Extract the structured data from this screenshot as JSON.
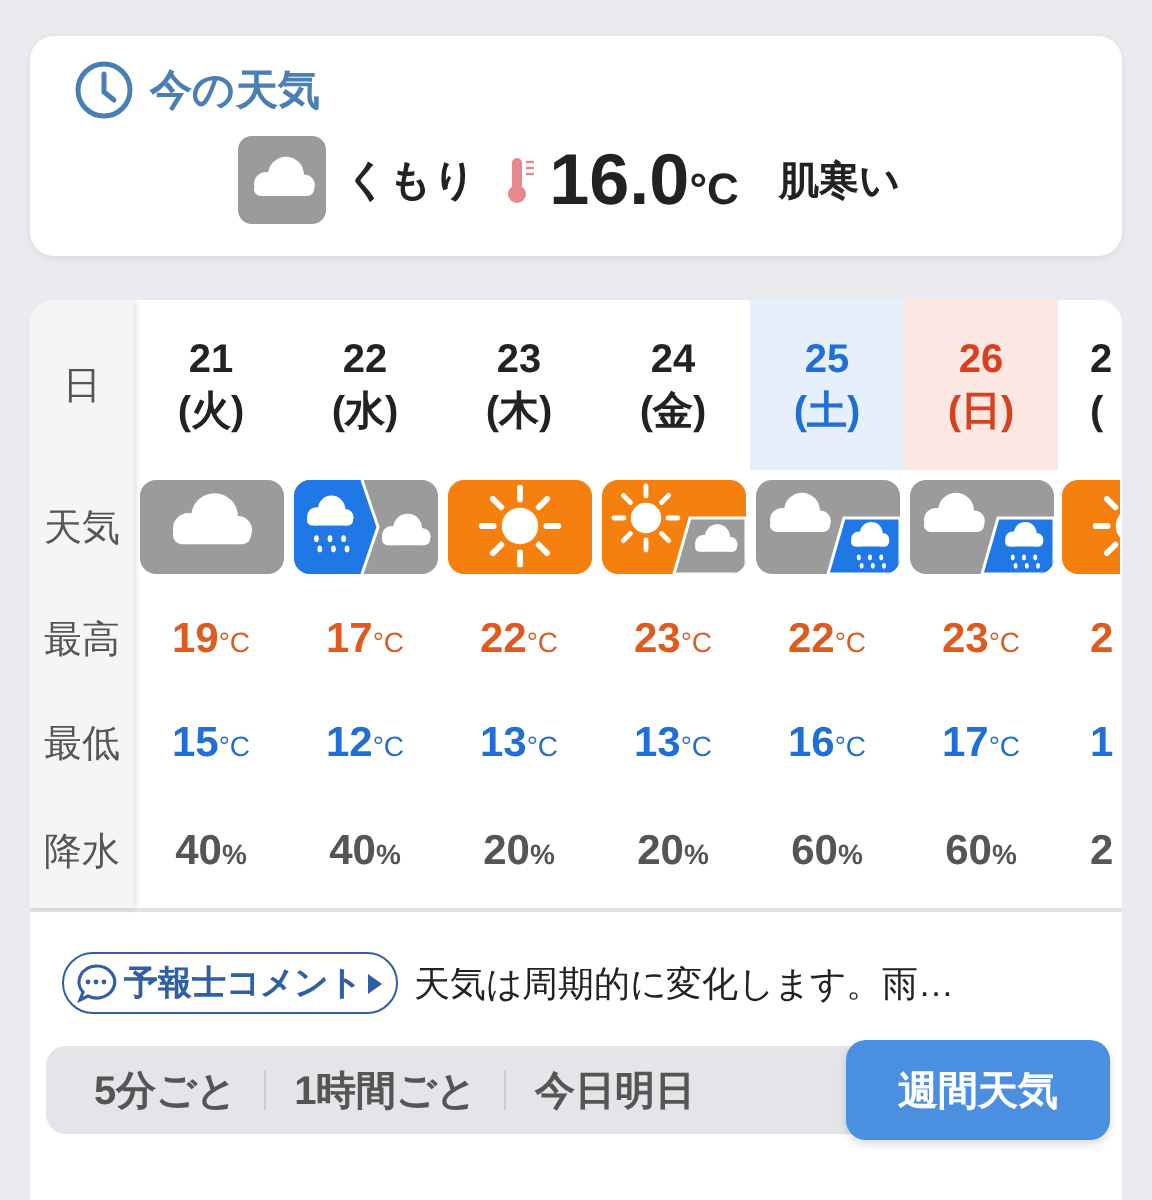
{
  "now": {
    "title": "今の天気",
    "condition": "くもり",
    "condition_icon": {
      "kind": "cloudy"
    },
    "temperature": "16.0",
    "unit": "°C",
    "feel": "肌寒い"
  },
  "week": {
    "row_labels": [
      "日",
      "天気",
      "最高",
      "最低",
      "降水"
    ],
    "days": [
      {
        "date": "21",
        "weekday": "(火)",
        "kind": "weekday",
        "weather": {
          "kind": "cloudy"
        },
        "high": {
          "value": "19",
          "unit": "°C"
        },
        "low": {
          "value": "15",
          "unit": "°C"
        },
        "precip": {
          "value": "40",
          "unit": "%"
        }
      },
      {
        "date": "22",
        "weekday": "(水)",
        "kind": "weekday",
        "weather": {
          "kind": "rain_then_cloudy"
        },
        "high": {
          "value": "17",
          "unit": "°C"
        },
        "low": {
          "value": "12",
          "unit": "°C"
        },
        "precip": {
          "value": "40",
          "unit": "%"
        }
      },
      {
        "date": "23",
        "weekday": "(木)",
        "kind": "weekday",
        "weather": {
          "kind": "sunny"
        },
        "high": {
          "value": "22",
          "unit": "°C"
        },
        "low": {
          "value": "13",
          "unit": "°C"
        },
        "precip": {
          "value": "20",
          "unit": "%"
        }
      },
      {
        "date": "24",
        "weekday": "(金)",
        "kind": "weekday",
        "weather": {
          "kind": "sunny_sometimes_cloudy"
        },
        "high": {
          "value": "23",
          "unit": "°C"
        },
        "low": {
          "value": "13",
          "unit": "°C"
        },
        "precip": {
          "value": "20",
          "unit": "%"
        }
      },
      {
        "date": "25",
        "weekday": "(土)",
        "kind": "saturday",
        "weather": {
          "kind": "cloudy_sometimes_rain"
        },
        "high": {
          "value": "22",
          "unit": "°C"
        },
        "low": {
          "value": "16",
          "unit": "°C"
        },
        "precip": {
          "value": "60",
          "unit": "%"
        }
      },
      {
        "date": "26",
        "weekday": "(日)",
        "kind": "sunday",
        "weather": {
          "kind": "cloudy_sometimes_rain"
        },
        "high": {
          "value": "23",
          "unit": "°C"
        },
        "low": {
          "value": "17",
          "unit": "°C"
        },
        "precip": {
          "value": "60",
          "unit": "%"
        }
      }
    ],
    "partial_day": {
      "date": "2",
      "weekday": "(",
      "weather": {
        "kind": "sunny"
      },
      "high": "2",
      "low": "1",
      "precip": "2"
    }
  },
  "comment": {
    "button": "予報士コメント",
    "text": "天気は周期的に変化します。雨…"
  },
  "tabs": [
    {
      "label": "5分ごと",
      "selected": false
    },
    {
      "label": "1時間ごと",
      "selected": false
    },
    {
      "label": "今日明日",
      "selected": false
    },
    {
      "label": "週間天気",
      "selected": true
    }
  ]
}
